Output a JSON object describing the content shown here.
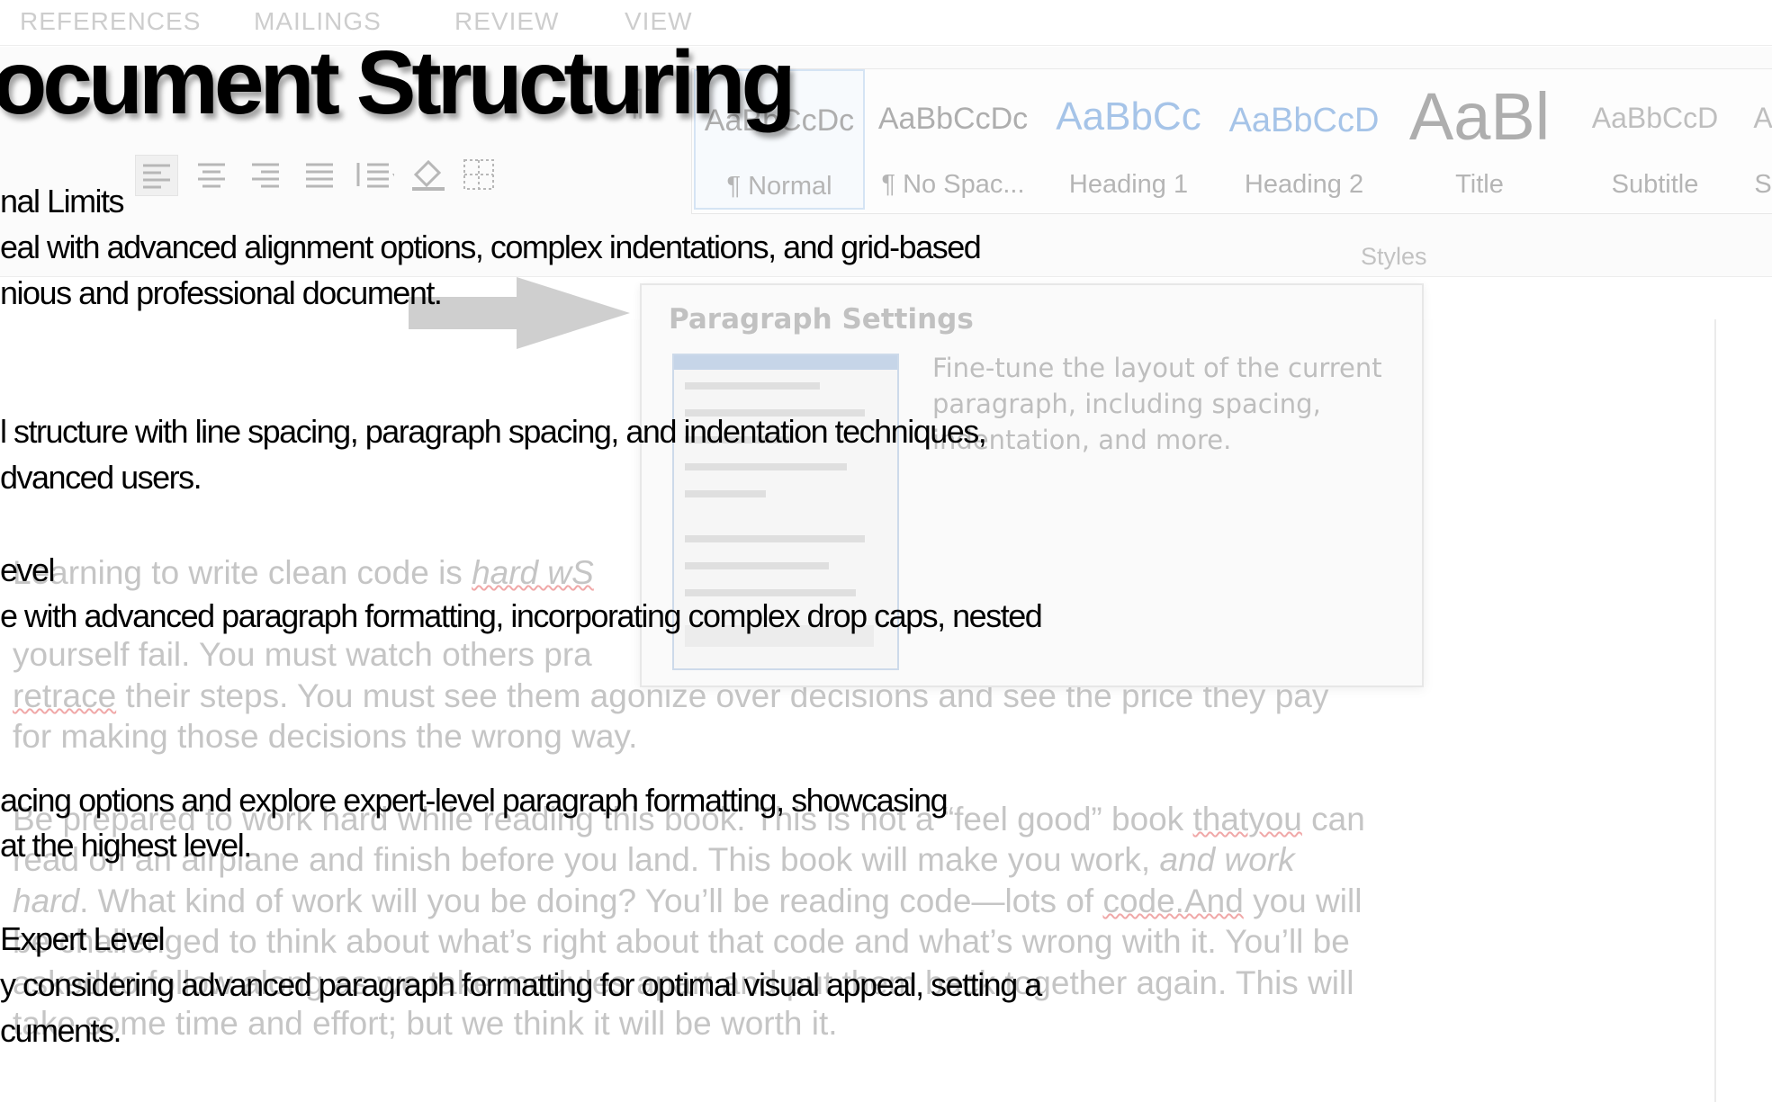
{
  "ribbon": {
    "tabs": [
      "REFERENCES",
      "MAILINGS",
      "REVIEW",
      "VIEW"
    ],
    "pilcrow": "¶",
    "styles": [
      {
        "sample": "AaBbCcDc",
        "name": "¶ Normal"
      },
      {
        "sample": "AaBbCcDc",
        "name": "¶ No Spac..."
      },
      {
        "sample": "AaBbCc",
        "name": "Heading 1"
      },
      {
        "sample": "AaBbCcD",
        "name": "Heading 2"
      },
      {
        "sample": "AaBl",
        "name": "Title"
      },
      {
        "sample": "AaBbCcD",
        "name": "Subtitle"
      },
      {
        "sample": "A",
        "name": "S"
      }
    ],
    "styles_group_label": "Styles"
  },
  "tooltip": {
    "title": "Paragraph Settings",
    "description": "Fine-tune the layout of the current paragraph, including spacing, indentation, and more."
  },
  "document": {
    "lines": [
      {
        "text": "Learning to write clean code is ",
        "italic": "hard wS"
      },
      {
        "text": "yourself fail. You must watch others pra"
      },
      {
        "squiggle": "retrace",
        "text": " their steps. You must see them agonize over decisions and see the price they pay"
      },
      {
        "text": "for making those decisions the wrong way."
      },
      {
        "text": "Be prepared to work hard while reading this book. This is not a “feel good” book ",
        "squiggle": "thatyou",
        "tail": " can"
      },
      {
        "text": "read on an airplane and finish before you land. This book will make you work, ",
        "italic": "and work"
      },
      {
        "italic": "hard",
        "text": ". What kind of work will you be doing? You’ll be reading code—lots of ",
        "squiggle": "code.And",
        "tail": " you will"
      },
      {
        "text": "be challenged to think about what’s right about that code and what’s wrong with it. You’ll be"
      },
      {
        "text": "asked to follow along as we take modules apart and put them back together again. This will"
      },
      {
        "text": "take some time and effort; but we think it will be worth it."
      }
    ]
  },
  "overlay": {
    "title": "Document Structuring",
    "lines": [
      "nal Limits",
      "eal with advanced alignment options, complex indentations, and grid-based",
      "nious and professional document.",
      "l structure with line spacing, paragraph spacing, and indentation techniques,",
      "dvanced users.",
      "evel",
      "e with advanced paragraph formatting, incorporating complex drop caps, nested",
      "acing options and explore expert-level paragraph formatting, showcasing",
      "at the highest level.",
      "Expert Level",
      "y considering advanced paragraph formatting for optimal visual appeal, setting a",
      "cuments."
    ]
  }
}
